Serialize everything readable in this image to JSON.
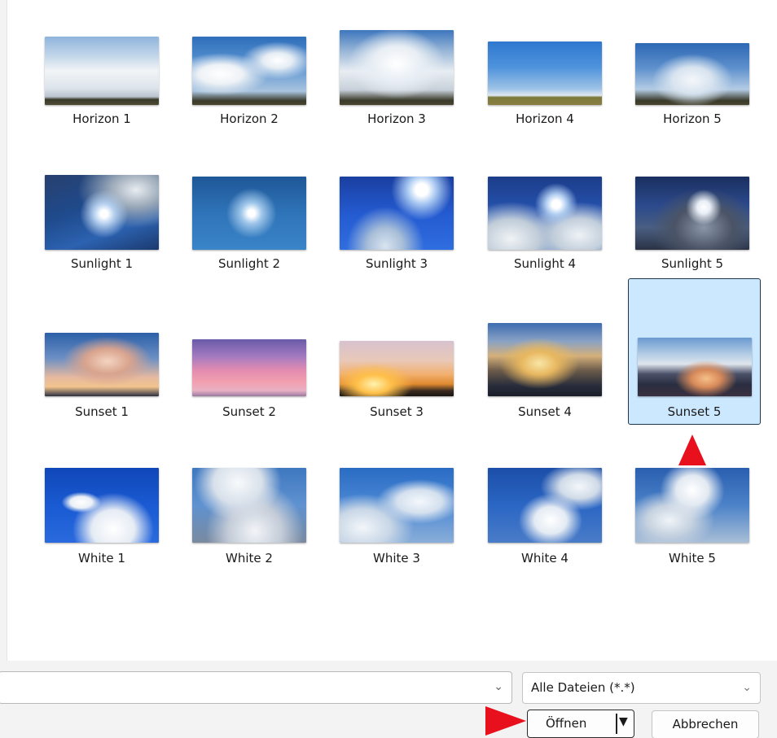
{
  "gallery": {
    "items": [
      {
        "label": "Horizon 1",
        "selected": false
      },
      {
        "label": "Horizon 2",
        "selected": false
      },
      {
        "label": "Horizon 3",
        "selected": false
      },
      {
        "label": "Horizon 4",
        "selected": false
      },
      {
        "label": "Horizon 5",
        "selected": false
      },
      {
        "label": "Sunlight 1",
        "selected": false
      },
      {
        "label": "Sunlight 2",
        "selected": false
      },
      {
        "label": "Sunlight 3",
        "selected": false
      },
      {
        "label": "Sunlight 4",
        "selected": false
      },
      {
        "label": "Sunlight 5",
        "selected": false
      },
      {
        "label": "Sunset 1",
        "selected": false
      },
      {
        "label": "Sunset 2",
        "selected": false
      },
      {
        "label": "Sunset 3",
        "selected": false
      },
      {
        "label": "Sunset 4",
        "selected": false
      },
      {
        "label": "Sunset 5",
        "selected": true
      },
      {
        "label": "White 1",
        "selected": false
      },
      {
        "label": "White 2",
        "selected": false
      },
      {
        "label": "White 3",
        "selected": false
      },
      {
        "label": "White 4",
        "selected": false
      },
      {
        "label": "White 5",
        "selected": false
      }
    ]
  },
  "footer": {
    "filename_value": "",
    "filter_value": "Alle Dateien (*.*)",
    "open_label": "Öffnen",
    "cancel_label": "Abbrechen"
  },
  "colors": {
    "selection_bg": "#cce8ff",
    "selection_border": "#1f3550",
    "annotation_marker": "#e8101c"
  },
  "icons": {
    "combo_chevron": "chevron-down-icon",
    "split_dropdown": "dropdown-arrow-icon"
  }
}
